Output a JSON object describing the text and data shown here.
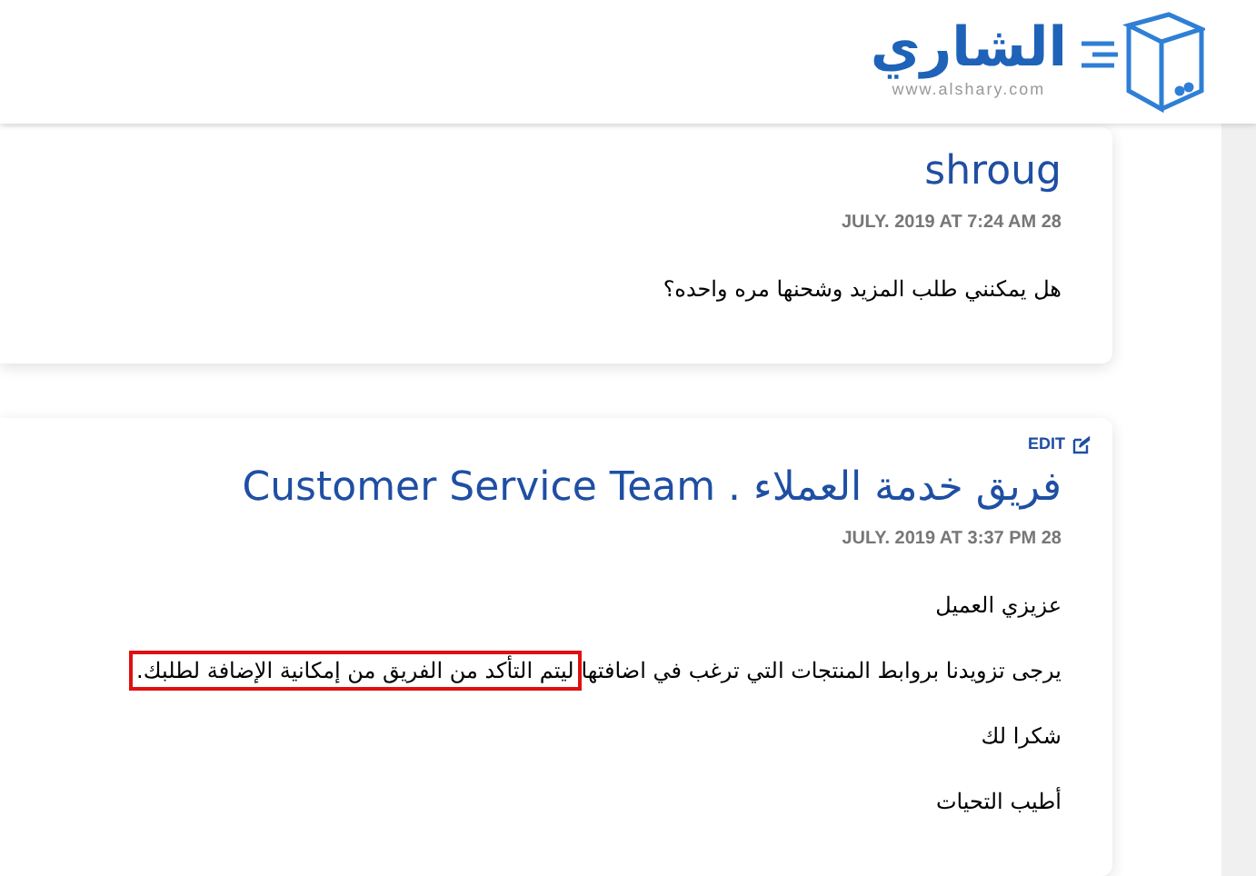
{
  "header": {
    "logo_text": "الشاري",
    "logo_url": "www.alshary.com"
  },
  "comments": [
    {
      "author": "shroug",
      "date": "JULY. 2019 AT 7:24 AM 28",
      "edit": false,
      "paragraphs": [
        [
          {
            "text": "هل يمكنني طلب المزيد وشحنها مره واحده؟",
            "boxed": false
          }
        ]
      ]
    },
    {
      "author": "فريق خدمة العملاء . Customer Service Team",
      "date": "JULY. 2019 AT 3:37 PM 28",
      "edit": true,
      "edit_label": "EDIT",
      "paragraphs": [
        [
          {
            "text": "عزيزي العميل",
            "boxed": false
          }
        ],
        [
          {
            "text": "يرجى تزويدنا بروابط المنتجات التي ترغب في اضافتها",
            "boxed": false
          },
          {
            "text": "ليتم التأكد من الفريق من إمكانية الإضافة لطلبك.",
            "boxed": true
          }
        ],
        [
          {
            "text": "شكرا لك",
            "boxed": false
          }
        ],
        [
          {
            "text": "أطيب التحيات",
            "boxed": false
          }
        ]
      ]
    }
  ]
}
